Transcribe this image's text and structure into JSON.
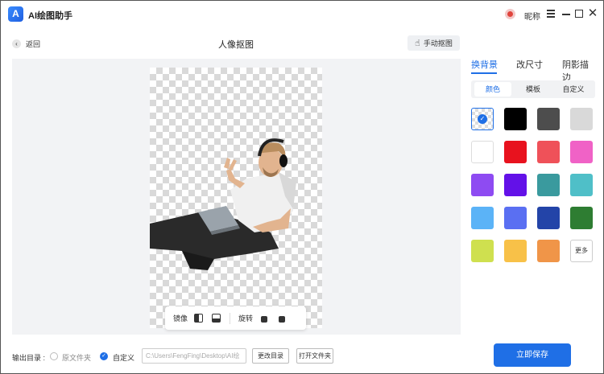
{
  "app": {
    "logo_letter": "A",
    "title": "AI绘图助手",
    "user_name": "昵称"
  },
  "topbar": {
    "back_label": "返回",
    "page_title": "人像抠图",
    "manual_label": "手动抠图"
  },
  "canvas": {
    "tools": {
      "mirror_label": "镜像",
      "rotate_label": "旋转"
    }
  },
  "panel": {
    "tabs": [
      "换背景",
      "改尺寸",
      "阴影描边"
    ],
    "active_tab": "换背景",
    "segments": [
      "颜色",
      "模板",
      "自定义"
    ],
    "active_segment": "颜色",
    "swatches": [
      "transparent",
      "#000000",
      "#4d4d4d",
      "#d9d9d9",
      "#ffffff",
      "#e8121e",
      "#ef5159",
      "#f062c6",
      "#8e4bf2",
      "#6311e8",
      "#3a9a9e",
      "#4fbfc8",
      "#5bb3f7",
      "#5a6ff2",
      "#2344a8",
      "#2e7d32",
      "#cfe04f",
      "#f8c148",
      "#f09548"
    ],
    "more_label": "更多"
  },
  "bottom": {
    "output_label": "输出目录 :",
    "option_original": "原文件夹",
    "option_custom": "自定义",
    "path_value": "C:\\Users\\FengFing\\Desktop\\AI绘",
    "change_dir_label": "更改目录",
    "open_folder_label": "打开文件夹",
    "save_label": "立即保存"
  },
  "colors": {
    "accent": "#1f6fe6"
  }
}
